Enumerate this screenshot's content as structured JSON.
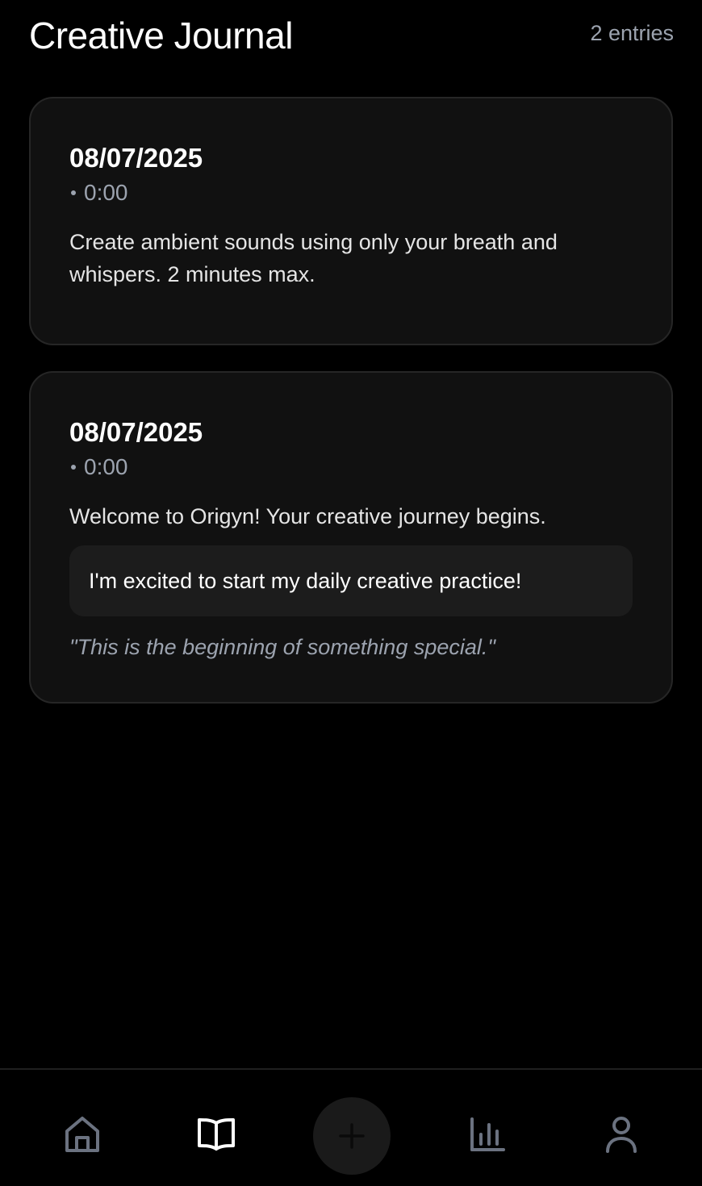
{
  "header": {
    "title": "Creative Journal",
    "entry_count": "2 entries"
  },
  "entries": [
    {
      "date": "08/07/2025",
      "time": "0:00",
      "prompt": "Create ambient sounds using only your breath and whispers. 2 minutes max."
    },
    {
      "date": "08/07/2025",
      "time": "0:00",
      "prompt": "Welcome to Origyn! Your creative journey begins.",
      "response": "I'm excited to start my daily creative practice!",
      "reflection": "\"This is the beginning of something special.\""
    }
  ],
  "nav": {
    "items": [
      {
        "icon": "home-icon",
        "active": false
      },
      {
        "icon": "book-icon",
        "active": true
      },
      {
        "icon": "plus-icon",
        "active": false
      },
      {
        "icon": "bar-chart-icon",
        "active": false
      },
      {
        "icon": "user-icon",
        "active": false
      }
    ]
  },
  "colors": {
    "background": "#000000",
    "card": "#111111",
    "card_border": "#262626",
    "muted_text": "#9ca3af",
    "inactive_icon": "#6b7280",
    "active_icon": "#ffffff"
  }
}
